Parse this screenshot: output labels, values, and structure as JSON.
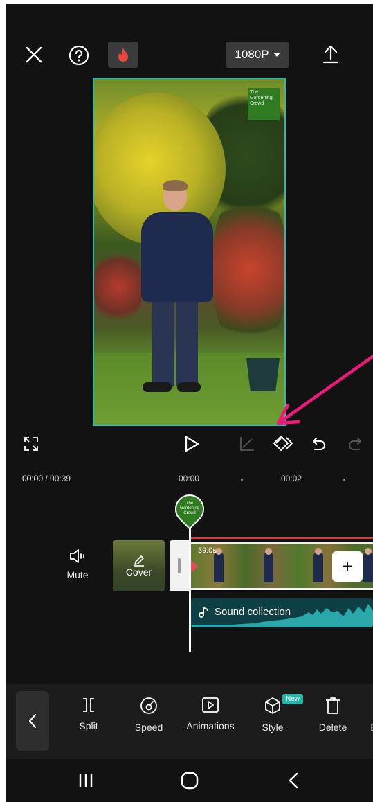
{
  "topbar": {
    "close_icon": "close-icon",
    "help_icon": "help-icon",
    "pro_icon": "flame-icon",
    "resolution": "1080P",
    "export_icon": "upload-icon"
  },
  "preview": {
    "watermark_line1": "The",
    "watermark_line2": "Gardening",
    "watermark_line3": "Crowd",
    "border_color": "#2fb9b4"
  },
  "annotation": {
    "arrow_color": "#f0197a"
  },
  "playback": {
    "fullscreen_icon": "fullscreen-icon",
    "play_icon": "play-icon",
    "keyframe_graph_icon": "keyframe-graph-icon",
    "keyframe_icon": "keyframe-icon",
    "undo_icon": "undo-icon",
    "redo_icon": "redo-icon"
  },
  "timeline": {
    "current_time": "00:00",
    "total_time": "/ 00:39",
    "ruler": [
      "00:00",
      "00:02"
    ],
    "mute_label": "Mute",
    "cover_label": "Cover",
    "clip_duration": "39.0s",
    "playhead_text": "The Gardening Crowd",
    "sound_label": "Sound collection",
    "sound_color": "#2aa7a8"
  },
  "toolbar": {
    "items": [
      {
        "label": "Split",
        "icon": "split-icon"
      },
      {
        "label": "Speed",
        "icon": "speed-icon"
      },
      {
        "label": "Animations",
        "icon": "animations-icon"
      },
      {
        "label": "Style",
        "icon": "style-icon",
        "badge": "New"
      },
      {
        "label": "Delete",
        "icon": "delete-icon"
      },
      {
        "label": "E",
        "icon": "edit-icon"
      }
    ]
  },
  "navbar": {
    "recent_icon": "recent-apps-icon",
    "home_icon": "home-icon",
    "back_icon": "back-icon"
  }
}
